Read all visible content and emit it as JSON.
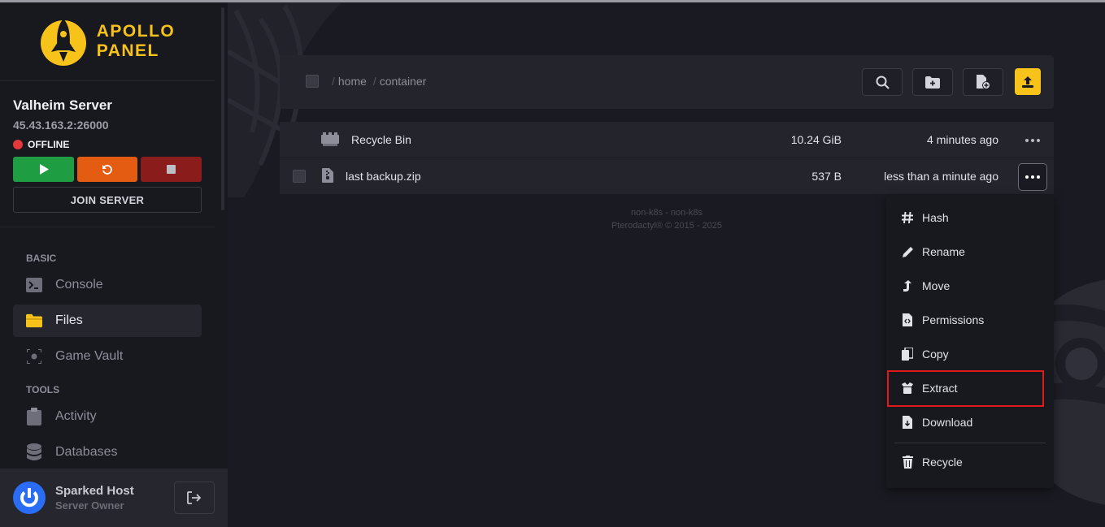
{
  "brand": {
    "line1": "APOLLO",
    "line2": "PANEL",
    "accent": "#f7c21a"
  },
  "server": {
    "name": "Valheim Server",
    "ip": "45.43.163.2:26000",
    "status": "OFFLINE",
    "status_color": "#e5383b",
    "join_label": "JOIN SERVER",
    "power": [
      {
        "name": "start",
        "icon": "play-icon",
        "color": "#1f9d43"
      },
      {
        "name": "restart",
        "icon": "restart-icon",
        "color": "#e35c12"
      },
      {
        "name": "stop",
        "icon": "stop-icon",
        "color": "#8b1c1c"
      }
    ]
  },
  "nav": {
    "basic_label": "BASIC",
    "tools_label": "TOOLS",
    "items": [
      {
        "label": "Console",
        "icon": "terminal-icon",
        "active": false
      },
      {
        "label": "Files",
        "icon": "folder-icon",
        "active": true
      },
      {
        "label": "Game Vault",
        "icon": "vault-icon",
        "active": false
      },
      {
        "label": "Activity",
        "icon": "clipboard-icon",
        "active": false
      },
      {
        "label": "Databases",
        "icon": "database-icon",
        "active": false
      }
    ]
  },
  "user": {
    "name": "Sparked Host",
    "role": "Server Owner"
  },
  "breadcrumb": {
    "parts": [
      "home",
      "container"
    ],
    "separator": "/"
  },
  "toolbar": {
    "buttons": [
      "search-icon",
      "new-folder-icon",
      "new-file-icon",
      "upload-icon"
    ]
  },
  "files": [
    {
      "name": "Recycle Bin",
      "icon": "recycle-bin-icon",
      "size": "10.24 GiB",
      "modified": "4 minutes ago",
      "selectable": false
    },
    {
      "name": "last backup.zip",
      "icon": "archive-file-icon",
      "size": "537 B",
      "modified": "less than a minute ago",
      "selectable": true
    }
  ],
  "footer_info": {
    "line1": "non-k8s - non-k8s",
    "line2": "Pterodactyl® © 2015 - 2025"
  },
  "context_menu": {
    "items": [
      {
        "label": "Hash",
        "icon": "hash-icon"
      },
      {
        "label": "Rename",
        "icon": "pencil-icon"
      },
      {
        "label": "Move",
        "icon": "move-arrow-icon"
      },
      {
        "label": "Permissions",
        "icon": "file-code-icon"
      },
      {
        "label": "Copy",
        "icon": "copy-icon"
      },
      {
        "label": "Extract",
        "icon": "box-open-icon",
        "highlighted": true
      },
      {
        "label": "Download",
        "icon": "file-download-icon"
      },
      {
        "label": "Recycle",
        "icon": "trash-icon"
      }
    ],
    "highlight_color": "#e0191b"
  }
}
